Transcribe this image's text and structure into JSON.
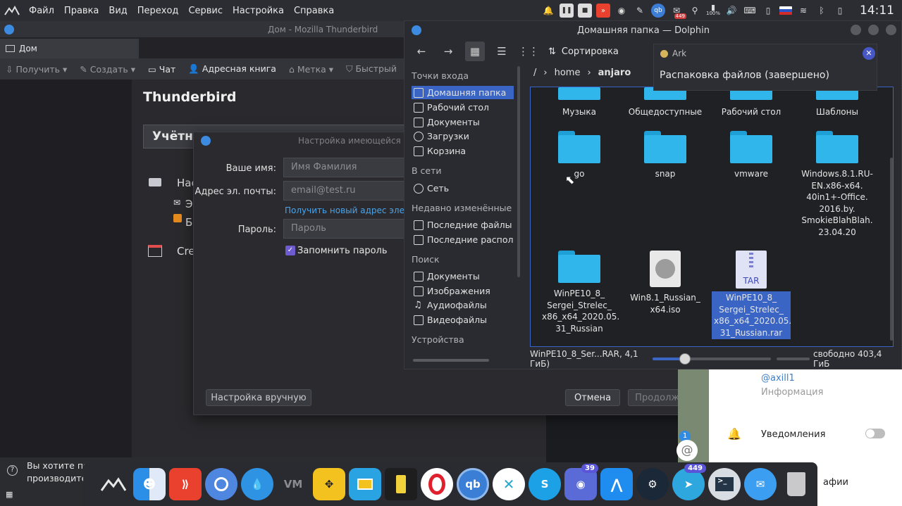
{
  "topbar": {
    "menu": [
      "Файл",
      "Правка",
      "Вид",
      "Переход",
      "Сервис",
      "Настройка",
      "Справка"
    ],
    "battery": "100%",
    "mail_badge": "449",
    "qb": "qb",
    "clock": "14:11"
  },
  "thunderbird": {
    "window_title": "Дом - Mozilla Thunderbird",
    "tab_label": "Дом",
    "toolbar": {
      "get": "Получить",
      "create": "Создать",
      "chat": "Чат",
      "addressbook": "Адресная книга",
      "tag": "Метка",
      "quick": "Быстрый"
    },
    "heading": "Thunderbird",
    "account_box": "Учётн",
    "rows": {
      "r1": "Нас",
      "r2": "Э",
      "r3": "Б",
      "r4": "Cre"
    }
  },
  "dialog": {
    "title": "Настройка имеющейся у",
    "name_label": "Ваше имя:",
    "name_placeholder": "Имя Фамилия",
    "email_label": "Адрес эл. почты:",
    "email_placeholder": "email@test.ru",
    "new_address_link": "Получить новый адрес электр",
    "password_label": "Пароль:",
    "password_placeholder": "Пароль",
    "remember_label": "Запомнить пароль",
    "manual_button": "Настройка вручную",
    "cancel_button": "Отмена",
    "continue_button": "Продолжить"
  },
  "dolphin": {
    "title": "Домашняя папка — Dolphin",
    "sort_label": "Сортировка",
    "places": {
      "entry_points": "Точки входа",
      "home": "Домашняя папка",
      "desktop": "Рабочий стол",
      "documents": "Документы",
      "downloads": "Загрузки",
      "trash": "Корзина",
      "network_section": "В сети",
      "network": "Сеть",
      "recent_section": "Недавно изменённые",
      "recent_files": "Последние файлы",
      "recent_locations": "Последние располож",
      "search_section": "Поиск",
      "search_documents": "Документы",
      "search_images": "Изображения",
      "search_audio": "Аудиофайлы",
      "search_video": "Видеофайлы",
      "devices_section": "Устройства"
    },
    "breadcrumb": {
      "root": "/",
      "home": "home",
      "user": "anjaro"
    },
    "files": {
      "music": "Музыка",
      "public": "Общедоступные",
      "desktop": "Рабочий стол",
      "templates": "Шаблоны",
      "go": "go",
      "snap": "snap",
      "vmware": "vmware",
      "windows": "Windows.8.1.RU-EN.x86-x64. 40in1+-Office. 2016.by. SmokieBlahBlah. 23.04.20",
      "winpe_dir": "WinPE10_8_ Sergei_Strelec_ x86_x64_2020.05. 31_Russian",
      "iso": "Win8.1_Russian_ x64.iso",
      "rar": "WinPE10_8_ Sergei_Strelec_ x86_x64_2020.05. 31_Russian.rar",
      "tar_badge": "TAR"
    },
    "status": {
      "selected": "WinPE10_8_Ser...RAR, 4,1 ГиБ)",
      "free": "свободно 403,4 ГиБ"
    }
  },
  "ark": {
    "app": "Ark",
    "message": "Распаковка файлов (завершено)"
  },
  "right_app": {
    "handle": "@axill1",
    "info": "Информация",
    "notifications": "Уведомления",
    "bottom_text": "афии",
    "count_badge": "1"
  },
  "notice": {
    "line1": "Вы хотите пом",
    "line2": "производите"
  },
  "dock": {
    "anydesk": "⟫",
    "vm": "VM",
    "qbittorrent": "qb",
    "skype": "S",
    "discord_badge": "39",
    "telegram_badge": "449"
  },
  "colors": {
    "accent": "#3a65c4",
    "folder": "#30b6ea",
    "top_bar": "#2b2d33"
  }
}
